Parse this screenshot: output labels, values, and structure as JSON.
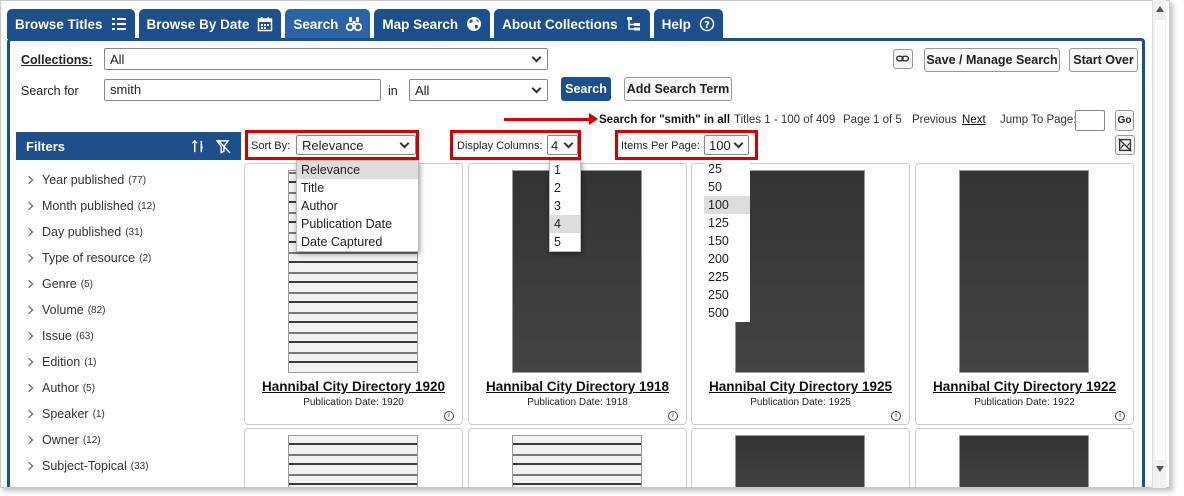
{
  "tabs": [
    {
      "label": "Browse Titles",
      "icon": "list-icon"
    },
    {
      "label": "Browse By Date",
      "icon": "calendar-icon"
    },
    {
      "label": "Search",
      "icon": "binoculars-icon"
    },
    {
      "label": "Map Search",
      "icon": "globe-icon"
    },
    {
      "label": "About Collections",
      "icon": "hierarchy-icon"
    },
    {
      "label": "Help",
      "icon": "help-icon"
    }
  ],
  "search": {
    "collections_label": "Collections:",
    "collections_value": "All",
    "search_for_label": "Search for",
    "search_value": "smith",
    "in_label": "in",
    "in_value": "All",
    "search_button": "Search",
    "add_term_button": "Add Search Term",
    "save_manage_button": "Save / Manage Search",
    "start_over_button": "Start Over"
  },
  "results_bar": {
    "query_text": "Search for \"smith\" in all",
    "titles_range": "Titles 1 - 100 of 409",
    "page_info": "Page 1 of 5",
    "previous": "Previous",
    "next": "Next",
    "jump_label": "Jump To Page:",
    "go": "Go"
  },
  "controls": {
    "sort_label": "Sort By:",
    "sort_value": "Relevance",
    "sort_options": [
      "Relevance",
      "Title",
      "Author",
      "Publication Date",
      "Date Captured"
    ],
    "columns_label": "Display Columns:",
    "columns_value": "4",
    "columns_options": [
      "1",
      "2",
      "3",
      "4",
      "5"
    ],
    "per_page_label": "Items Per Page:",
    "per_page_value": "100",
    "per_page_options": [
      "25",
      "50",
      "100",
      "125",
      "150",
      "200",
      "225",
      "250",
      "500"
    ]
  },
  "filters": {
    "title": "Filters",
    "items": [
      {
        "label": "Year published",
        "count": "(77)"
      },
      {
        "label": "Month published",
        "count": "(12)"
      },
      {
        "label": "Day published",
        "count": "(31)"
      },
      {
        "label": "Type of resource",
        "count": "(2)"
      },
      {
        "label": "Genre",
        "count": "(5)"
      },
      {
        "label": "Volume",
        "count": "(82)"
      },
      {
        "label": "Issue",
        "count": "(63)"
      },
      {
        "label": "Edition",
        "count": "(1)"
      },
      {
        "label": "Author",
        "count": "(5)"
      },
      {
        "label": "Speaker",
        "count": "(1)"
      },
      {
        "label": "Owner",
        "count": "(12)"
      },
      {
        "label": "Subject-Topical",
        "count": "(33)"
      }
    ]
  },
  "results": [
    {
      "title": "Hannibal City Directory 1920",
      "pub_date": "Publication Date: 1920"
    },
    {
      "title": "Hannibal City Directory 1918",
      "pub_date": "Publication Date: 1918"
    },
    {
      "title": "Hannibal City Directory 1925",
      "pub_date": "Publication Date: 1925"
    },
    {
      "title": "Hannibal City Directory 1922",
      "pub_date": "Publication Date: 1922"
    }
  ],
  "colors": {
    "brand": "#1d4f8c",
    "highlight": "#d40000"
  }
}
